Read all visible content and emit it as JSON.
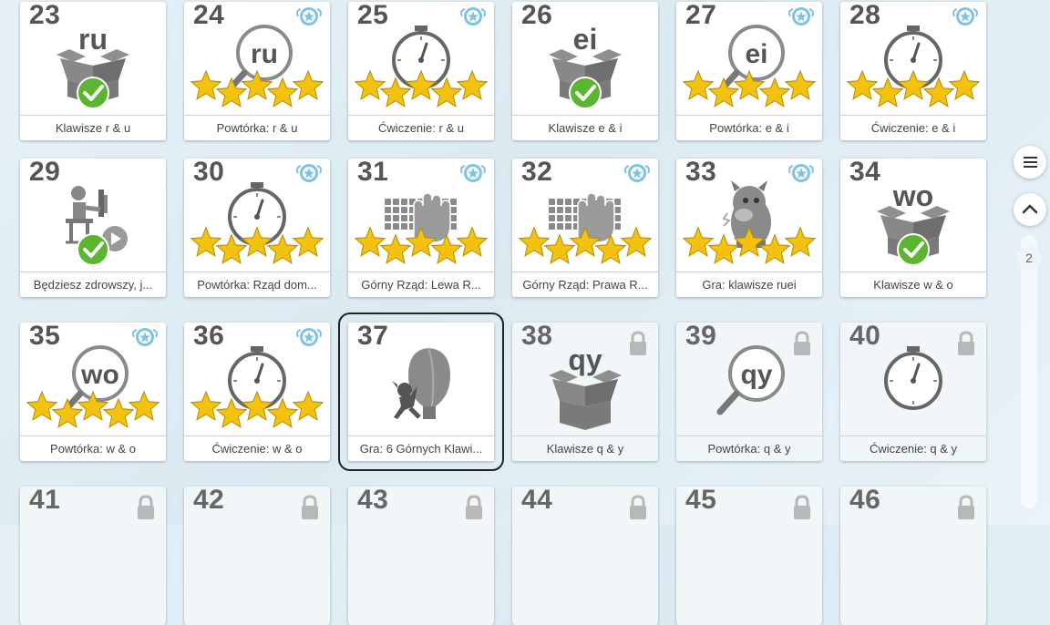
{
  "lessons": [
    {
      "num": "23",
      "label": "Klawisze r & u",
      "icon": "box-letters-icon",
      "letters": "ru",
      "status": "complete",
      "badge": false,
      "locked": false
    },
    {
      "num": "24",
      "label": "Powtórka: r & u",
      "icon": "magnifier-letters-icon",
      "letters": "ru",
      "status": "stars",
      "badge": true,
      "locked": false
    },
    {
      "num": "25",
      "label": "Ćwiczenie: r & u",
      "icon": "stopwatch-icon",
      "status": "stars",
      "badge": true,
      "locked": false
    },
    {
      "num": "26",
      "label": "Klawisze e & i",
      "icon": "box-letters-icon",
      "letters": "ei",
      "status": "complete",
      "badge": false,
      "locked": false
    },
    {
      "num": "27",
      "label": "Powtórka: e & i",
      "icon": "magnifier-letters-icon",
      "letters": "ei",
      "status": "stars",
      "badge": true,
      "locked": false
    },
    {
      "num": "28",
      "label": "Ćwiczenie: e & i",
      "icon": "stopwatch-icon",
      "status": "stars",
      "badge": true,
      "locked": false
    },
    {
      "num": "29",
      "label": "Będziesz zdrowszy, j...",
      "icon": "ergonomics-video-icon",
      "status": "complete",
      "badge": false,
      "locked": false
    },
    {
      "num": "30",
      "label": "Powtórka: Rząd dom...",
      "icon": "stopwatch-icon",
      "status": "stars",
      "badge": true,
      "locked": false
    },
    {
      "num": "31",
      "label": "Górny Rząd: Lewa R...",
      "icon": "keyboard-hand-icon",
      "status": "stars",
      "badge": true,
      "locked": false
    },
    {
      "num": "32",
      "label": "Górny Rząd: Prawa R...",
      "icon": "keyboard-hand-icon",
      "status": "stars",
      "badge": true,
      "locked": false
    },
    {
      "num": "33",
      "label": "Gra: klawisze ruei",
      "icon": "monster-game-icon",
      "status": "stars",
      "badge": true,
      "locked": false
    },
    {
      "num": "34",
      "label": "Klawisze w & o",
      "icon": "box-letters-icon",
      "letters": "wo",
      "status": "complete",
      "badge": false,
      "locked": false
    },
    {
      "num": "35",
      "label": "Powtórka: w & o",
      "icon": "magnifier-letters-icon",
      "letters": "wo",
      "status": "stars",
      "badge": true,
      "locked": false
    },
    {
      "num": "36",
      "label": "Ćwiczenie: w & o",
      "icon": "stopwatch-icon",
      "status": "stars",
      "badge": true,
      "locked": false
    },
    {
      "num": "37",
      "label": "Gra: 6 Górnych Klawi...",
      "icon": "ninja-balloon-game-icon",
      "status": "none",
      "badge": false,
      "locked": false,
      "selected": true
    },
    {
      "num": "38",
      "label": "Klawisze q & y",
      "icon": "box-letters-icon",
      "letters": "qy",
      "status": "none",
      "badge": false,
      "locked": true
    },
    {
      "num": "39",
      "label": "Powtórka: q & y",
      "icon": "magnifier-letters-icon",
      "letters": "qy",
      "status": "none",
      "badge": false,
      "locked": true
    },
    {
      "num": "40",
      "label": "Ćwiczenie: q & y",
      "icon": "stopwatch-icon",
      "status": "none",
      "badge": false,
      "locked": true
    },
    {
      "num": "41",
      "label": "",
      "icon": "",
      "status": "none",
      "badge": false,
      "locked": true
    },
    {
      "num": "42",
      "label": "",
      "icon": "",
      "status": "none",
      "badge": false,
      "locked": true
    },
    {
      "num": "43",
      "label": "",
      "icon": "",
      "status": "none",
      "badge": false,
      "locked": true
    },
    {
      "num": "44",
      "label": "",
      "icon": "",
      "status": "none",
      "badge": false,
      "locked": true
    },
    {
      "num": "45",
      "label": "",
      "icon": "",
      "status": "none",
      "badge": false,
      "locked": true
    },
    {
      "num": "46",
      "label": "",
      "icon": "",
      "status": "none",
      "badge": false,
      "locked": true
    }
  ],
  "rail": {
    "menu_icon": "hamburger-menu-icon",
    "up_icon": "chevron-up-icon",
    "page_indicator": "2"
  },
  "colors": {
    "star": "#f2c20f",
    "check": "#5cb530",
    "badge": "#7cc3e6",
    "icon_gray": "#777777"
  }
}
